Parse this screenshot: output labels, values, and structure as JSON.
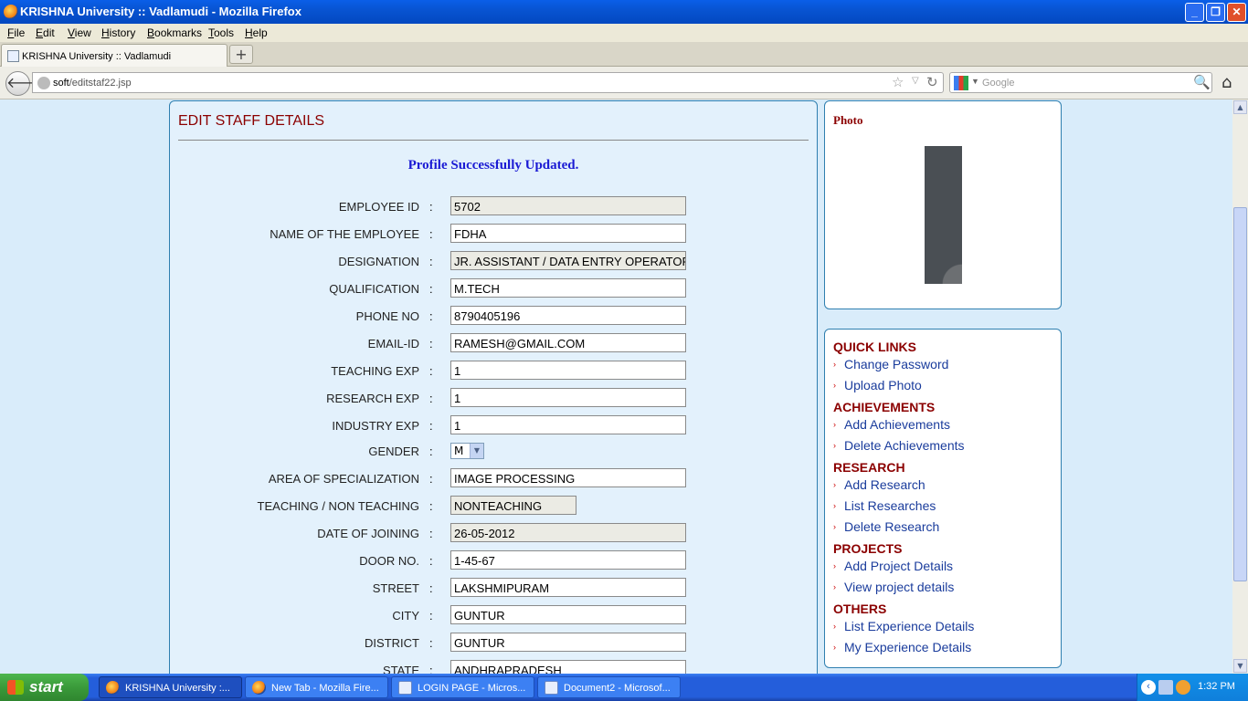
{
  "window": {
    "title": "KRISHNA University :: Vadlamudi - Mozilla Firefox"
  },
  "menu": [
    "File",
    "Edit",
    "View",
    "History",
    "Bookmarks",
    "Tools",
    "Help"
  ],
  "tab": {
    "label": "KRISHNA University :: Vadlamudi"
  },
  "url": {
    "host": "soft",
    "path": "/editstaf22.jsp"
  },
  "search": {
    "placeholder": "Google"
  },
  "main": {
    "heading": "EDIT STAFF DETAILS",
    "message": "Profile Successfully Updated.",
    "fields": [
      {
        "label": "EMPLOYEE ID",
        "value": "5702",
        "readonly": true
      },
      {
        "label": "NAME OF THE EMPLOYEE",
        "value": "FDHA"
      },
      {
        "label": "DESIGNATION",
        "value": "JR. ASSISTANT / DATA ENTRY OPERATOR",
        "readonly": true
      },
      {
        "label": "QUALIFICATION",
        "value": "M.TECH"
      },
      {
        "label": "PHONE NO",
        "value": "8790405196"
      },
      {
        "label": "EMAIL-ID",
        "value": "RAMESH@GMAIL.COM"
      },
      {
        "label": "TEACHING EXP",
        "value": "1"
      },
      {
        "label": "RESEARCH EXP",
        "value": "1"
      },
      {
        "label": "INDUSTRY EXP",
        "value": "1"
      },
      {
        "label": "GENDER",
        "value": "M",
        "type": "select"
      },
      {
        "label": "AREA OF SPECIALIZATION",
        "value": "IMAGE PROCESSING"
      },
      {
        "label": "TEACHING / NON TEACHING",
        "value": "NONTEACHING",
        "readonly": true
      },
      {
        "label": "DATE OF JOINING",
        "value": "26-05-2012",
        "readonly": true
      },
      {
        "label": "DOOR NO.",
        "value": "1-45-67"
      },
      {
        "label": "STREET",
        "value": "LAKSHMIPURAM"
      },
      {
        "label": "CITY",
        "value": "GUNTUR"
      },
      {
        "label": "DISTRICT",
        "value": "GUNTUR"
      },
      {
        "label": "STATE",
        "value": "ANDHRAPRADESH"
      }
    ]
  },
  "photo": {
    "heading": "Photo"
  },
  "sidebar": {
    "sections": [
      {
        "title": "QUICK LINKS",
        "links": [
          "Change Password",
          "Upload Photo"
        ]
      },
      {
        "title": "ACHIEVEMENTS",
        "links": [
          "Add Achievements",
          "Delete Achievements"
        ]
      },
      {
        "title": "RESEARCH",
        "links": [
          "Add Research",
          "List Researches",
          "Delete Research"
        ]
      },
      {
        "title": "PROJECTS",
        "links": [
          "Add Project Details",
          "View project details"
        ]
      },
      {
        "title": "OTHERS",
        "links": [
          "List Experience Details",
          "My Experience Details"
        ]
      }
    ]
  },
  "taskbar": {
    "start": "start",
    "tasks": [
      "KRISHNA University :...",
      "New Tab - Mozilla Fire...",
      "LOGIN PAGE - Micros...",
      "Document2 - Microsof..."
    ],
    "clock": "1:32 PM"
  },
  "colors": {
    "heading": "#8b0000",
    "link": "#1a3c9c",
    "message": "#1b1bd4",
    "page_bg": "#d9ecfa"
  }
}
